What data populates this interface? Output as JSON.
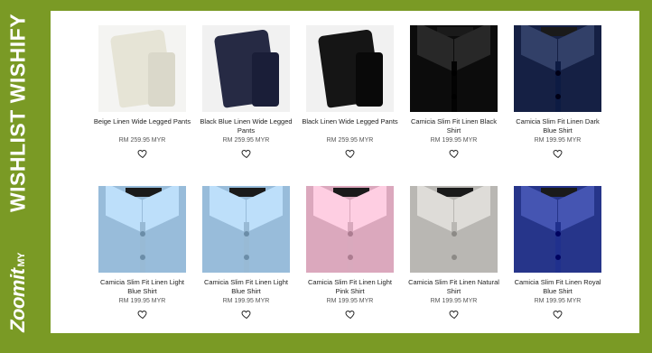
{
  "sidebar": {
    "title": "WISHLIST WISHIFY",
    "brand": "Zoomit",
    "brand_sub": "MY"
  },
  "products": [
    {
      "name": "Beige Linen Wide Legged Pants",
      "price": "RM 259.95 MYR",
      "type": "pants",
      "color": "#e6e4d6",
      "bg": "#f4f4f2",
      "heart_icon": "heart-outline-icon"
    },
    {
      "name": "Black Blue Linen Wide Legged Pants",
      "price": "RM 259.95 MYR",
      "type": "pants",
      "color": "#262a44",
      "bg": "#f1f1f1",
      "heart_icon": "heart-outline-icon"
    },
    {
      "name": "Black Linen Wide Legged Pants",
      "price": "RM 259.95 MYR",
      "type": "pants",
      "color": "#151515",
      "bg": "#f1f1f1",
      "heart_icon": "heart-outline-icon"
    },
    {
      "name": "Camicia Slim Fit Linen Black Shirt",
      "price": "RM 199.95 MYR",
      "type": "shirt",
      "color": "#121212",
      "bg": "#0c0c0c",
      "heart_icon": "heart-outline-icon"
    },
    {
      "name": "Camicia Slim Fit Linen Dark Blue Shirt",
      "price": "RM 199.95 MYR",
      "type": "shirt",
      "color": "#1c2a52",
      "bg": "#152044",
      "heart_icon": "heart-outline-icon"
    },
    {
      "name": "Camicia Slim Fit Linen Light Blue Shirt",
      "price": "RM 199.95 MYR",
      "type": "shirt",
      "color": "#a7c9e4",
      "bg": "#98bcda",
      "heart_icon": "heart-outline-icon"
    },
    {
      "name": "Camicia Slim Fit Linen Light Blue Shirt",
      "price": "RM 199.95 MYR",
      "type": "shirt",
      "color": "#a7c9e4",
      "bg": "#98bcda",
      "heart_icon": "heart-outline-icon"
    },
    {
      "name": "Camicia Slim Fit Linen Light Pink Shirt",
      "price": "RM 199.95 MYR",
      "type": "shirt",
      "color": "#e8b8cc",
      "bg": "#dba8bd",
      "heart_icon": "heart-outline-icon"
    },
    {
      "name": "Camicia Slim Fit Linen Natural Shirt",
      "price": "RM 199.95 MYR",
      "type": "shirt",
      "color": "#c8c6c2",
      "bg": "#b9b7b3",
      "heart_icon": "heart-outline-icon"
    },
    {
      "name": "Camicia Slim Fit Linen Royal Blue Shirt",
      "price": "RM 199.95 MYR",
      "type": "shirt",
      "color": "#2f3f9c",
      "bg": "#26358a",
      "heart_icon": "heart-outline-icon"
    }
  ]
}
